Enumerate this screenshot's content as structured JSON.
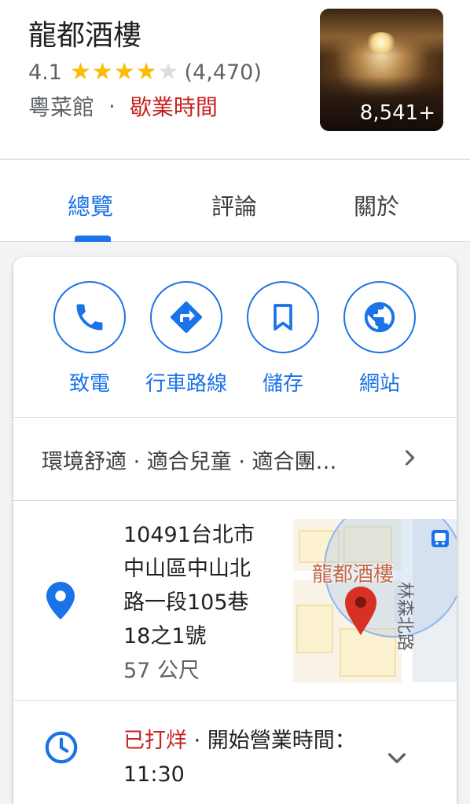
{
  "place": {
    "name": "龍都酒樓",
    "rating": "4.1",
    "rating_stars": 4.1,
    "review_count": "(4,470)",
    "category": "粵菜館",
    "separator": "·",
    "hours_link": "歇業時間",
    "photo_count": "8,541+"
  },
  "tabs": [
    {
      "label": "總覽",
      "active": true
    },
    {
      "label": "評論",
      "active": false
    },
    {
      "label": "關於",
      "active": false
    }
  ],
  "actions": [
    {
      "label": "致電",
      "icon": "phone-icon"
    },
    {
      "label": "行車路線",
      "icon": "directions-icon"
    },
    {
      "label": "儲存",
      "icon": "bookmark-icon"
    },
    {
      "label": "網站",
      "icon": "globe-icon"
    }
  ],
  "amenities": "環境舒適 · 適合兒童 · 適合團…",
  "address": {
    "line1": "10491台北市",
    "line2": "中山區中山北",
    "line3": "路一段105巷",
    "line4": "18之1號",
    "distance": "57 公尺"
  },
  "map": {
    "place_label": "龍都酒樓",
    "road_label": "林森北路"
  },
  "hours": {
    "status": "已打烊",
    "detail": " · 開始營業時間：11:30"
  },
  "colors": {
    "accent": "#1a73e8",
    "closed": "#c5221f",
    "star": "#fbbc04"
  }
}
